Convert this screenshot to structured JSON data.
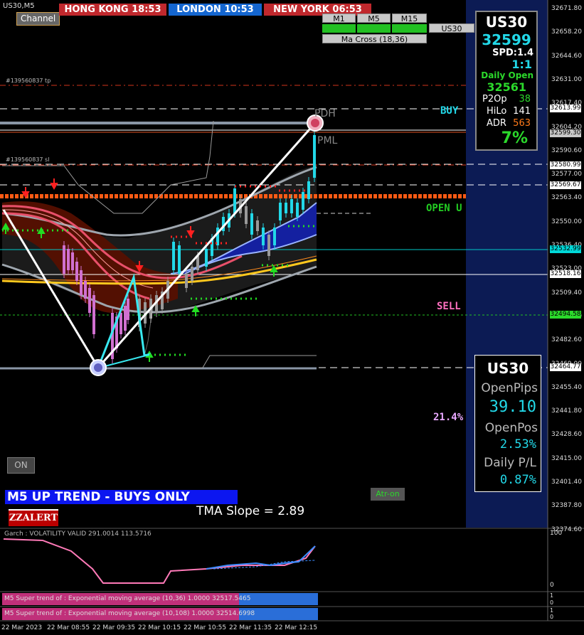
{
  "symbol_title": "US30,M5",
  "channel_button": "Channel",
  "sessions": [
    {
      "city": "HONG KONG",
      "time": "18:53",
      "color": "#c0282d"
    },
    {
      "city": "LONDON",
      "time": "10:53",
      "color": "#1466d0"
    },
    {
      "city": "NEW YORK",
      "time": "06:53",
      "color": "#c0282d"
    }
  ],
  "timeframes": [
    "M1",
    "M5",
    "M15"
  ],
  "symbol_button": "US30",
  "ma_cross": "Ma Cross (18,36)",
  "top_panel": {
    "symbol": "US30",
    "price": "32599",
    "spread": "SPD:1.4",
    "ratio": "1:1",
    "daily_open_label": "Daily Open",
    "daily_open": "32561",
    "rows": [
      {
        "label": "P2Op",
        "value": "38",
        "color": "#2bd92b"
      },
      {
        "label": "HiLo",
        "value": "141",
        "color": "#ffffff"
      },
      {
        "label": "ADR",
        "value": "563",
        "color": "#ff7a1a"
      }
    ],
    "percent": "7%"
  },
  "bottom_panel": {
    "symbol": "US30",
    "open_pips_label": "OpenPips",
    "open_pips": "39.10",
    "open_pos_label": "OpenPos",
    "open_pos": "2.53%",
    "daily_pl_label": "Daily P/L",
    "daily_pl": "0.87%"
  },
  "chart_labels": {
    "tp_label": "#139560837 tp",
    "sl_label": "#139560837 sl",
    "pdh": "PDH",
    "pml": "PML",
    "buy": "BUY",
    "open": "OPEN U",
    "sell": "SELL",
    "fib_percent": "21.4%"
  },
  "on_button": "ON",
  "trend_banner": "M5 UP TREND - BUYS ONLY",
  "zzalert": "ZZALERT",
  "tma_slope": "TMA Slope = 2.89",
  "atr_button": "Atr-on",
  "price_axis": [
    "32671.80",
    "32658.20",
    "32644.60",
    "32631.00",
    "32617.40",
    "32604.20",
    "32590.60",
    "32577.00",
    "32563.40",
    "32550.00",
    "32536.40",
    "32523.00",
    "32509.40",
    "32495.80",
    "32482.60",
    "32469.00",
    "32455.40",
    "32441.80",
    "32428.60",
    "32415.00",
    "32401.40",
    "32387.80",
    "32374.60"
  ],
  "price_tags": [
    {
      "value": "32613.99",
      "color": "#ffffff"
    },
    {
      "value": "32599.30",
      "color": "#c8c8c8"
    },
    {
      "value": "32580.99",
      "color": "#ffffff"
    },
    {
      "value": "32569.67",
      "color": "#ffffff"
    },
    {
      "value": "32532.99",
      "color": "#00d8d8"
    },
    {
      "value": "32518.16",
      "color": "#ffffff"
    },
    {
      "value": "32494.58",
      "color": "#2bd92b"
    },
    {
      "value": "32464.77",
      "color": "#ffffff"
    }
  ],
  "volatility_label": "Garch : VOLATILITY VALID 291.0014 113.5716",
  "vol_axis": [
    "100",
    "0"
  ],
  "supertrend1": "M5  Super trend of : Exponential moving average (10,36)  1.0000 32517.5465",
  "supertrend2": "M5  Super trend of : Exponential moving average (10,108)  1.0000 32514.6998",
  "st_axis1": [
    "1",
    "0"
  ],
  "st_axis2": [
    "1",
    "0"
  ],
  "time_axis": [
    "22 Mar 2023",
    "22 Mar 08:55",
    "22 Mar 09:35",
    "22 Mar 10:15",
    "22 Mar 10:55",
    "22 Mar 11:35",
    "22 Mar 12:15"
  ]
}
